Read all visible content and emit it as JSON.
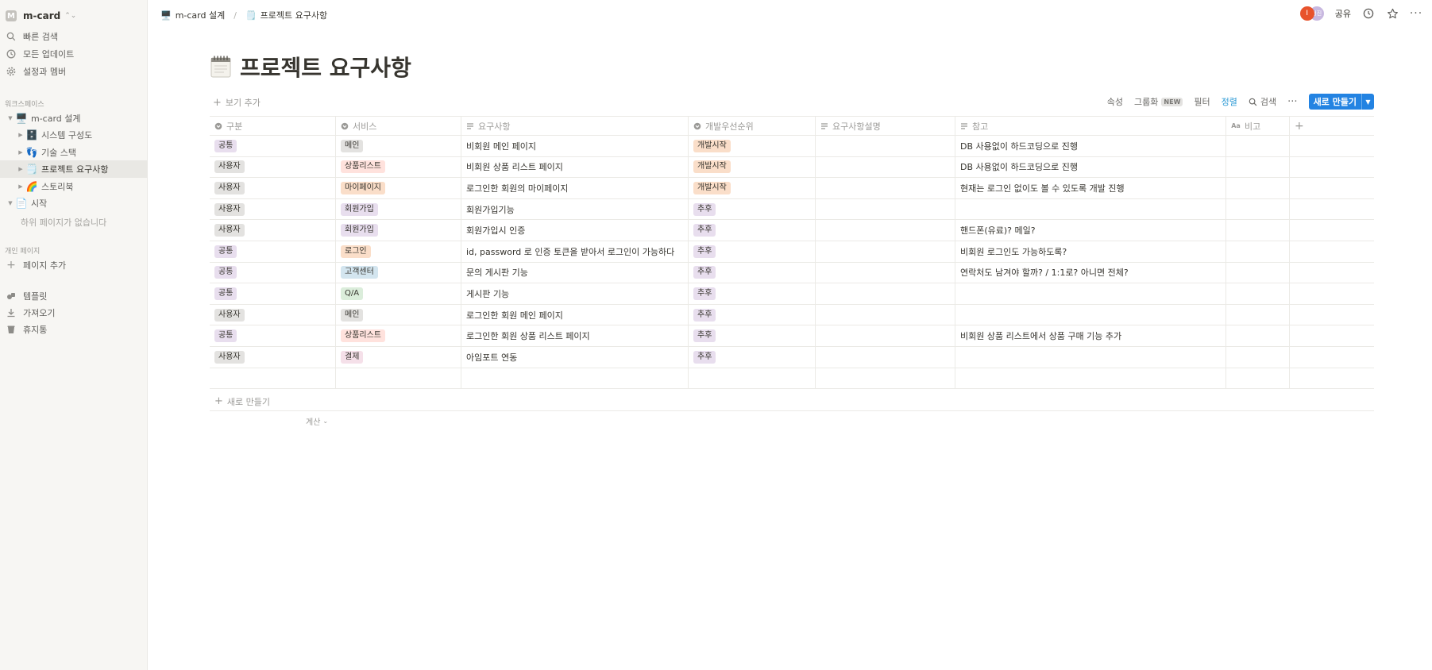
{
  "workspace": {
    "initial": "M",
    "name": "m-card"
  },
  "sidebar": {
    "top_items": [
      {
        "label": "빠른 검색",
        "icon": "search-icon"
      },
      {
        "label": "모든 업데이트",
        "icon": "clock-icon"
      },
      {
        "label": "설정과 멤버",
        "icon": "gear-icon"
      }
    ],
    "workspace_section": "워크스페이스",
    "tree": [
      {
        "label": "m-card 설계",
        "emoji": "🖥️",
        "level": 0,
        "expanded": true
      },
      {
        "label": "시스템 구성도",
        "emoji": "🗄️",
        "level": 1
      },
      {
        "label": "기술 스택",
        "emoji": "👣",
        "level": 1
      },
      {
        "label": "프로젝트 요구사항",
        "emoji": "🗒️",
        "level": 1,
        "active": true
      },
      {
        "label": "스토리북",
        "emoji": "🌈",
        "level": 1
      },
      {
        "label": "시작",
        "emoji": "📄",
        "level": 0,
        "expanded": true
      }
    ],
    "no_subpages": "하위 페이지가 없습니다",
    "private_section": "개인 페이지",
    "add_page": "페이지 추가",
    "bottom_items": [
      {
        "label": "템플릿",
        "icon": "template-icon"
      },
      {
        "label": "가져오기",
        "icon": "download-icon"
      },
      {
        "label": "휴지통",
        "icon": "trash-icon"
      }
    ]
  },
  "topbar": {
    "breadcrumb": [
      {
        "label": "m-card 설계",
        "emoji": "🖥️"
      },
      {
        "label": "프로젝트 요구사항",
        "emoji": "🗒️"
      }
    ],
    "separator": "/",
    "avatars": [
      "I",
      "형진"
    ],
    "share_label": "공유"
  },
  "page": {
    "emoji": "🗒️",
    "title": "프로젝트 요구사항"
  },
  "viewbar": {
    "add_view": "보기 추가",
    "properties": "속성",
    "group": "그룹화",
    "group_badge": "NEW",
    "filter": "필터",
    "sort": "정렬",
    "search": "검색",
    "more": "···",
    "new_button": "새로 만들기"
  },
  "table": {
    "columns": [
      {
        "label": "구분",
        "icon": "select-icon"
      },
      {
        "label": "서비스",
        "icon": "select-icon"
      },
      {
        "label": "요구사항",
        "icon": "text-icon"
      },
      {
        "label": "개발우선순위",
        "icon": "select-icon"
      },
      {
        "label": "요구사항설명",
        "icon": "text-icon"
      },
      {
        "label": "참고",
        "icon": "text-icon"
      },
      {
        "label": "비고",
        "icon": "text-type-icon"
      },
      {
        "label": "+",
        "icon": "add-icon"
      }
    ],
    "rows": [
      {
        "category": "공통",
        "category_color": "#e8deee",
        "service": "메인",
        "service_color": "#e3e2e0",
        "requirement": "비회원 메인 페이지",
        "priority": "개발시작",
        "priority_color": "#fadec9",
        "description": "",
        "note": "DB 사용없이 하드코딩으로 진행",
        "remark": ""
      },
      {
        "category": "사용자",
        "category_color": "#e3e2e0",
        "service": "상품리스트",
        "service_color": "#ffe2dd",
        "requirement": "비회원 상품 리스트 페이지",
        "priority": "개발시작",
        "priority_color": "#fadec9",
        "description": "",
        "note": "DB 사용없이 하드코딩으로 진행",
        "remark": ""
      },
      {
        "category": "사용자",
        "category_color": "#e3e2e0",
        "service": "마이페이지",
        "service_color": "#fadec9",
        "requirement": "로그인한 회원의 마이페이지",
        "priority": "개발시작",
        "priority_color": "#fadec9",
        "description": "",
        "note": "현재는 로그인 없이도 볼 수 있도록 개발 진행",
        "remark": ""
      },
      {
        "category": "사용자",
        "category_color": "#e3e2e0",
        "service": "회원가입",
        "service_color": "#e8deee",
        "requirement": "회원가입기능",
        "priority": "추후",
        "priority_color": "#e8deee",
        "description": "",
        "note": "",
        "remark": ""
      },
      {
        "category": "사용자",
        "category_color": "#e3e2e0",
        "service": "회원가입",
        "service_color": "#e8deee",
        "requirement": "회원가입시 인증",
        "priority": "추후",
        "priority_color": "#e8deee",
        "description": "",
        "note": "핸드폰(유료)? 메일?",
        "remark": ""
      },
      {
        "category": "공통",
        "category_color": "#e8deee",
        "service": "로그인",
        "service_color": "#fadec9",
        "requirement": "id, password 로 인증 토큰을 받아서 로그인이 가능하다",
        "priority": "추후",
        "priority_color": "#e8deee",
        "description": "",
        "note": "비회원 로그인도 가능하도록?",
        "remark": ""
      },
      {
        "category": "공통",
        "category_color": "#e8deee",
        "service": "고객센터",
        "service_color": "#d3e5ef",
        "requirement": "문의 게시판 기능",
        "priority": "추후",
        "priority_color": "#e8deee",
        "description": "",
        "note": "연락처도 남겨야 할까? / 1:1로? 아니면 전체?",
        "remark": ""
      },
      {
        "category": "공통",
        "category_color": "#e8deee",
        "service": "Q/A",
        "service_color": "#dbeddb",
        "requirement": "게시판 기능",
        "priority": "추후",
        "priority_color": "#e8deee",
        "description": "",
        "note": "",
        "remark": ""
      },
      {
        "category": "사용자",
        "category_color": "#e3e2e0",
        "service": "메인",
        "service_color": "#e3e2e0",
        "requirement": "로그인한 회원 메인 페이지",
        "priority": "추후",
        "priority_color": "#e8deee",
        "description": "",
        "note": "",
        "remark": ""
      },
      {
        "category": "공통",
        "category_color": "#e8deee",
        "service": "상품리스트",
        "service_color": "#ffe2dd",
        "requirement": "로그인한 회원 상품 리스트 페이지",
        "priority": "추후",
        "priority_color": "#e8deee",
        "description": "",
        "note": "비회원 상품 리스트에서 상품 구매 기능 추가",
        "remark": ""
      },
      {
        "category": "사용자",
        "category_color": "#e3e2e0",
        "service": "결제",
        "service_color": "#f5e0e9",
        "requirement": "아임포트 연동",
        "priority": "추후",
        "priority_color": "#e8deee",
        "description": "",
        "note": "",
        "remark": ""
      }
    ],
    "new_row": "새로 만들기",
    "calculate": "계산"
  },
  "colors": {
    "accent": "#2383e2",
    "sort_active": "#2e9bd6",
    "sidebar_bg": "#f7f6f3"
  }
}
